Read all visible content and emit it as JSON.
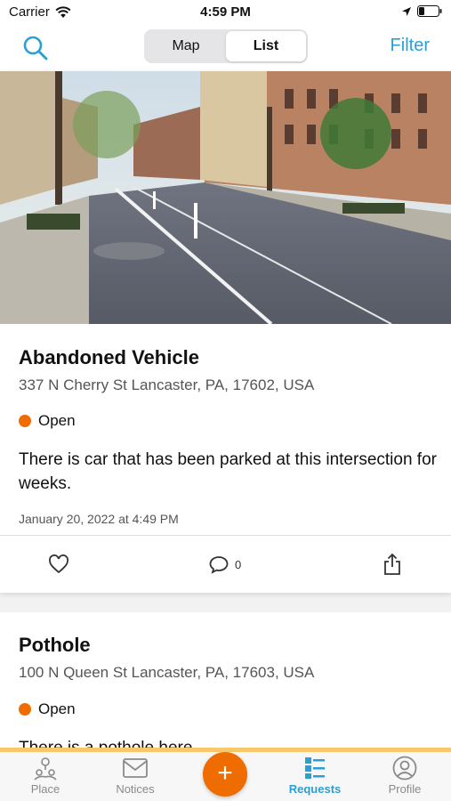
{
  "status_bar": {
    "carrier": "Carrier",
    "time": "4:59 PM"
  },
  "nav": {
    "segments": [
      {
        "label": "Map"
      },
      {
        "label": "List"
      }
    ],
    "active_segment": "List",
    "filter_label": "Filter",
    "accent_color": "#2a9fd6"
  },
  "requests": [
    {
      "title": "Abandoned Vehicle",
      "address": "337 N Cherry St Lancaster, PA, 17602, USA",
      "status": "Open",
      "status_color": "#ef6c00",
      "description": "There is car that has been parked at this intersection for weeks.",
      "date": "January 20, 2022 at 4:49 PM",
      "comment_count": "0"
    },
    {
      "title": "Pothole",
      "address": "100 N Queen St Lancaster, PA, 17603, USA",
      "status": "Open",
      "status_color": "#ef6c00",
      "description": "There is a pothole here."
    }
  ],
  "tab_bar": {
    "tabs": [
      {
        "label": "Place",
        "icon": "place-icon"
      },
      {
        "label": "Notices",
        "icon": "envelope-icon"
      },
      {
        "label": "Requests",
        "icon": "requests-list-icon"
      },
      {
        "label": "Profile",
        "icon": "profile-icon"
      }
    ],
    "active_tab": "Requests",
    "add_label": "+"
  }
}
